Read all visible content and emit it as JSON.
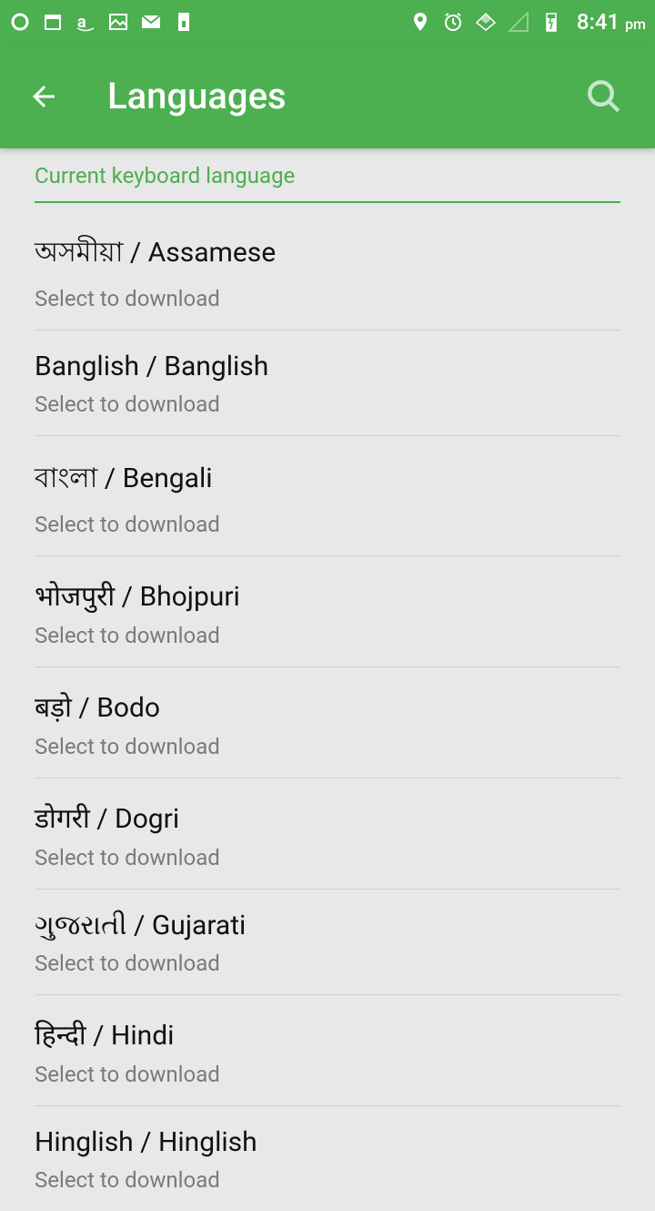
{
  "status": {
    "time": "8:41",
    "ampm": "pm"
  },
  "appbar": {
    "title": "Languages"
  },
  "section_title": "Current keyboard language",
  "languages": [
    {
      "name": "অসমীয়া / Assamese",
      "sub": "Select to download"
    },
    {
      "name": "Banglish / Banglish",
      "sub": "Select to download"
    },
    {
      "name": "বাংলা / Bengali",
      "sub": "Select to download"
    },
    {
      "name": "भोजपुरी / Bhojpuri",
      "sub": "Select to download"
    },
    {
      "name": "बड़ो / Bodo",
      "sub": "Select to download"
    },
    {
      "name": "डोगरी / Dogri",
      "sub": "Select to download"
    },
    {
      "name": "ગુજરાતી / Gujarati",
      "sub": "Select to download"
    },
    {
      "name": "हिन्दी / Hindi",
      "sub": "Select to download"
    },
    {
      "name": "Hinglish / Hinglish",
      "sub": "Select to download"
    }
  ]
}
